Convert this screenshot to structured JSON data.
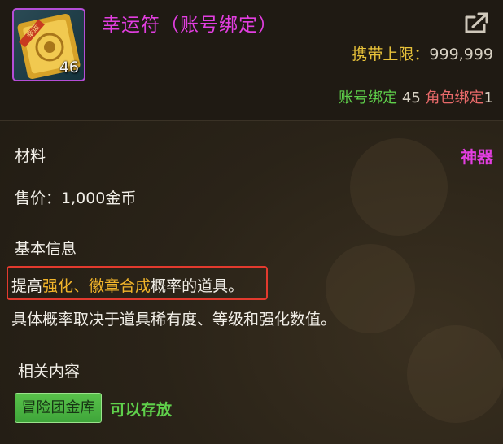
{
  "item": {
    "name": "幸运符（账号绑定）",
    "quantity": "46",
    "carry_label": "携带上限：",
    "carry_limit": "999,999",
    "account_bind_label": "账号绑定",
    "account_bind_count": "45",
    "role_bind_label": "角色绑定",
    "role_bind_count": "1",
    "icon": "lucky-charm-icon",
    "share_icon": "share-icon"
  },
  "details": {
    "category": "材料",
    "grade": "神器",
    "price": "售价：1,000金币",
    "basic_info_title": "基本信息",
    "desc_line1": {
      "prefix": "提高",
      "highlight1": "强化",
      "separator": "、",
      "highlight2": "徽章合成",
      "suffix": "概率的道具。"
    },
    "desc_line2": "具体概率取决于道具稀有度、等级和强化数值。",
    "related_title": "相关内容",
    "storage_tag": "冒险团金库",
    "storage_status": "可以存放"
  },
  "colors": {
    "title": "#e23ee0",
    "highlight": "#f2b52b",
    "label_gold": "#e8c23a",
    "green": "#5fd04b",
    "red_box": "#e23a2e"
  }
}
